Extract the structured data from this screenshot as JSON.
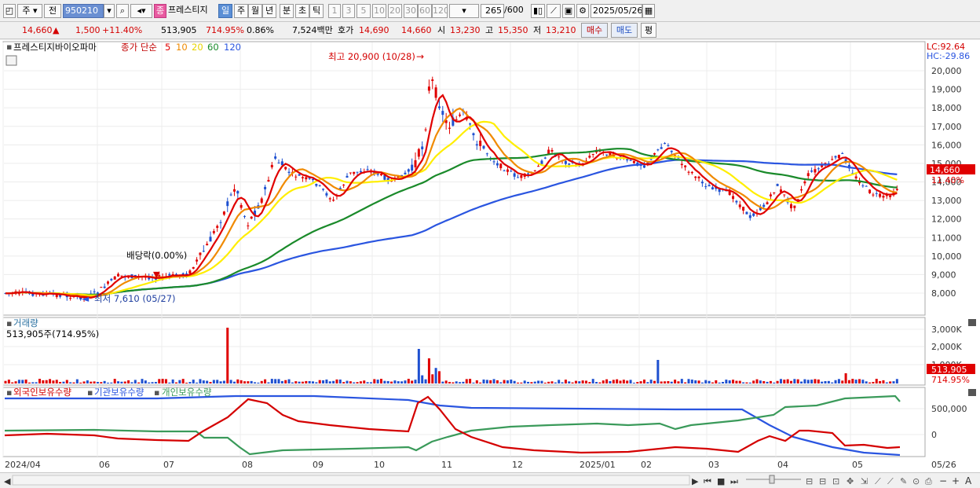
{
  "toolbar": {
    "period_type": "주",
    "prev_label": "전",
    "stock_code": "950210",
    "stock_name": "프레스티지",
    "badge": "종",
    "intervals": [
      "일",
      "주",
      "월",
      "년",
      "분",
      "초",
      "틱"
    ],
    "numbers": [
      "1",
      "3",
      "5",
      "10",
      "20",
      "30",
      "60",
      "120"
    ],
    "count_value": "265",
    "count_max": "/600",
    "date": "2025/05/26"
  },
  "quote": {
    "price": "14,660",
    "change": "1,500",
    "change_pct": "+11.40%",
    "volume": "513,905",
    "volume_ratio": "714.95%",
    "turnover": "0.86%",
    "amount": "7,524백만",
    "ask_label": "호가",
    "ask": "14,690",
    "bid": "14,660",
    "open_label": "시",
    "open": "13,230",
    "high_label": "고",
    "high": "15,350",
    "low_label": "저",
    "low": "13,210",
    "buy_button": "매수",
    "sell_button": "매도",
    "eval_button": "평"
  },
  "price_panel": {
    "title": "프레스티지바이오파마",
    "ma_label": "종가 단순",
    "ma_periods": [
      "5",
      "10",
      "20",
      "60",
      "120"
    ],
    "lc_label": "LC:92.64",
    "hc_label": "HC:-29.86",
    "high_annotation": "최고 20,900 (10/28)",
    "low_annotation": "최저 7,610 (05/27)",
    "dividend_annotation": "배당락(0.00%)",
    "current_price_tag": "14,660",
    "current_pct_tag": "11.40%",
    "y_ticks": [
      "20,000",
      "19,000",
      "18,000",
      "17,000",
      "16,000",
      "15,000",
      "14,000",
      "13,000",
      "12,000",
      "11,000",
      "10,000",
      "9,000",
      "8,000"
    ]
  },
  "volume_panel": {
    "title": "거래량",
    "value_label": "513,905주(714.95%)",
    "tag_value": "513,905",
    "tag_pct": "714.95%",
    "y_ticks": [
      "3,000K",
      "2,000K",
      "1,000K"
    ]
  },
  "holdings_panel": {
    "legend": [
      "외국인보유수량",
      "기관보유수량",
      "개인보유수량"
    ],
    "y_ticks": [
      "500,000",
      "0"
    ]
  },
  "x_axis": [
    "2024/04",
    "06",
    "07",
    "08",
    "09",
    "10",
    "11",
    "12",
    "2025/01",
    "02",
    "03",
    "04",
    "05",
    "05/26"
  ],
  "colors": {
    "candle_up": "#e00000",
    "candle_down": "#1e50d0",
    "ma5": "#e00000",
    "ma10": "#f08a00",
    "ma20": "#ffee00",
    "ma60": "#1a8a2a",
    "ma120": "#2a55e0",
    "foreign": "#d40000",
    "institution": "#2a55e0",
    "individual": "#3a9a5a"
  }
}
